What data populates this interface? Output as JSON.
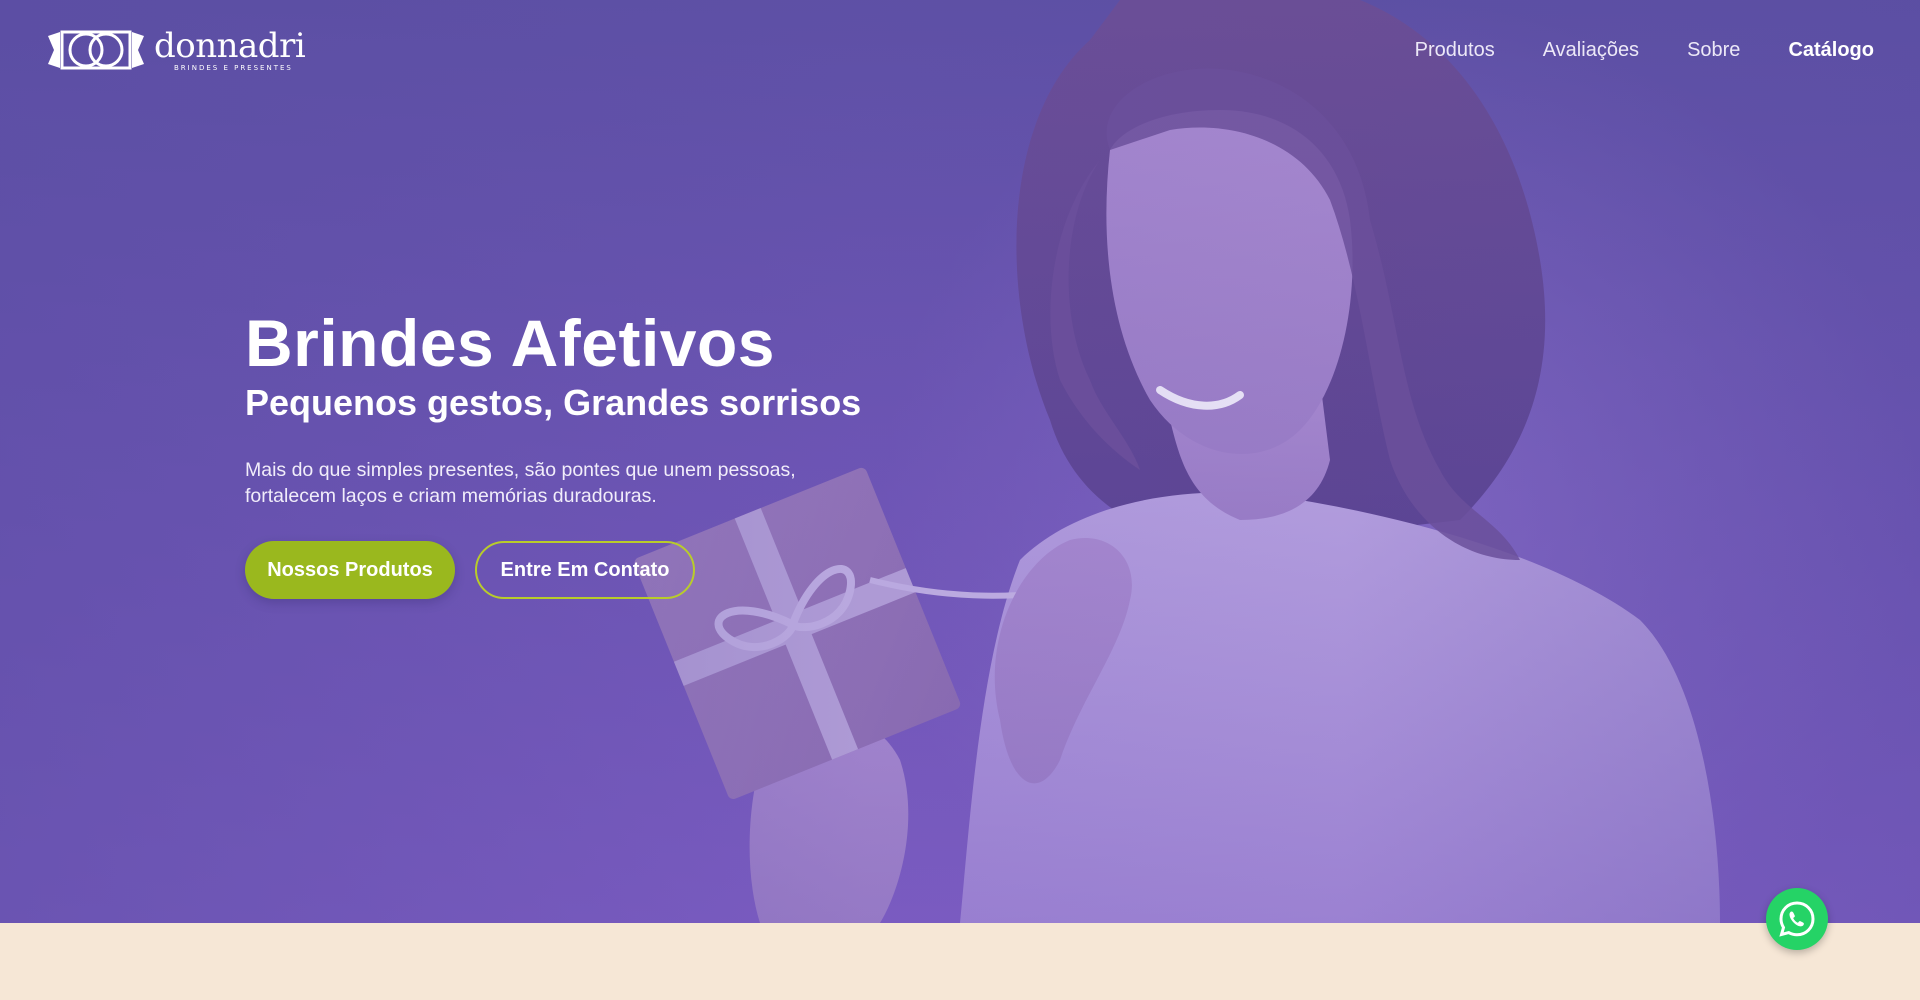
{
  "brand": {
    "name": "donnadri",
    "tagline": "BRINDES E PRESENTES"
  },
  "nav": {
    "items": [
      {
        "label": "Produtos"
      },
      {
        "label": "Avaliações"
      },
      {
        "label": "Sobre"
      },
      {
        "label": "Catálogo"
      }
    ]
  },
  "hero": {
    "title": "Brindes Afetivos",
    "subtitle": "Pequenos gestos, Grandes sorrisos",
    "description": "Mais do que simples presentes, são pontes que unem pessoas, fortalecem laços e criam memórias duradouras.",
    "primary_button": "Nossos Produtos",
    "secondary_button": "Entre Em Contato"
  },
  "colors": {
    "hero_purple": "#6e55b5",
    "accent_green": "#9ab81e",
    "whatsapp_green": "#25d366",
    "page_cream": "#f6e7d6"
  },
  "icons": {
    "whatsapp": "whatsapp-icon",
    "logo": "donnadri-logo-mark"
  }
}
